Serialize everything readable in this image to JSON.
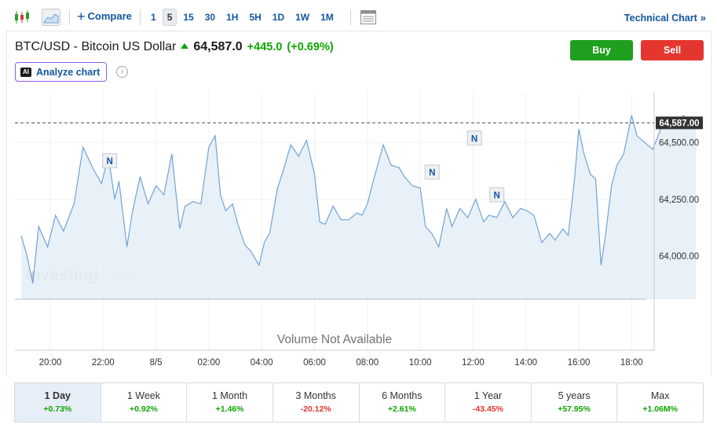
{
  "toolbar": {
    "compare_label": "Compare",
    "intervals": [
      "1",
      "5",
      "15",
      "30",
      "1H",
      "5H",
      "1D",
      "1W",
      "1M"
    ],
    "active_interval": "5",
    "technical_chart_label": "Technical Chart",
    "technical_chart_chevron": "»"
  },
  "asset": {
    "name": "BTC/USD - Bitcoin US Dollar",
    "price": "64,587.0",
    "change": "+445.0",
    "change_pct": "(+0.69%)",
    "direction_color": "#0ea600"
  },
  "actions": {
    "buy_label": "Buy",
    "sell_label": "Sell",
    "buy_color": "#1f9f1f",
    "sell_color": "#e5352f"
  },
  "analyze": {
    "badge": "AI",
    "label": "Analyze chart",
    "info_icon": "i"
  },
  "chart": {
    "watermark_brand": "Investing",
    "watermark_domain": ".com",
    "volume_message": "Volume Not Available",
    "news_marker": "N",
    "last_price_label": "64,587.00"
  },
  "chart_data": {
    "type": "area",
    "y_ticks": [
      "64,500.00",
      "64,250.00",
      "64,000.00"
    ],
    "y_tick_values": [
      64500,
      64250,
      64000
    ],
    "x_ticks": [
      "20:00",
      "22:00",
      "8/5",
      "02:00",
      "04:00",
      "06:00",
      "08:00",
      "10:00",
      "12:00",
      "14:00",
      "16:00",
      "18:00"
    ],
    "ylim": [
      63810,
      64720
    ],
    "last_price": 64587,
    "series": [
      {
        "color": "#6fa3d6",
        "fill": "#e4eef7",
        "x": [
          -0.55,
          -0.45,
          -0.33,
          -0.22,
          -0.05,
          0.1,
          0.25,
          0.45,
          0.62,
          0.8,
          0.97,
          1.1,
          1.22,
          1.3,
          1.45,
          1.55,
          1.7,
          1.85,
          2.0,
          2.15,
          2.3,
          2.45,
          2.55,
          2.7,
          2.85,
          3.0,
          3.12,
          3.22,
          3.32,
          3.45,
          3.55,
          3.68,
          3.8,
          3.95,
          4.05,
          4.15,
          4.3,
          4.4,
          4.55,
          4.7,
          4.85,
          5.0,
          5.1,
          5.2,
          5.35,
          5.5,
          5.65,
          5.8,
          5.9,
          6.0,
          6.1,
          6.3,
          6.45,
          6.6,
          6.7,
          6.85,
          7.0,
          7.1,
          7.22,
          7.35,
          7.5,
          7.6,
          7.75,
          7.9,
          8.05,
          8.2,
          8.3,
          8.45,
          8.6,
          8.75,
          8.9,
          9.02,
          9.15,
          9.3,
          9.45,
          9.55,
          9.7,
          9.8,
          9.92,
          10.0,
          10.1,
          10.22,
          10.32,
          10.42,
          10.5,
          10.62,
          10.72,
          10.85,
          11.0,
          11.1,
          11.25,
          11.4,
          11.55,
          11.7,
          11.85,
          11.98,
          12.1,
          12.22
        ],
        "y": [
          64090,
          64010,
          63880,
          64130,
          64040,
          64180,
          64110,
          64230,
          64480,
          64390,
          64320,
          64440,
          64250,
          64330,
          64040,
          64190,
          64350,
          64230,
          64310,
          64270,
          64450,
          64120,
          64220,
          64240,
          64230,
          64480,
          64530,
          64270,
          64200,
          64230,
          64140,
          64050,
          64020,
          63960,
          64060,
          64100,
          64300,
          64370,
          64490,
          64440,
          64510,
          64360,
          64150,
          64140,
          64220,
          64160,
          64160,
          64190,
          64180,
          64230,
          64320,
          64490,
          64400,
          64390,
          64350,
          64310,
          64300,
          64130,
          64100,
          64040,
          64210,
          64130,
          64210,
          64170,
          64250,
          64150,
          64180,
          64170,
          64240,
          64170,
          64210,
          64200,
          64180,
          64060,
          64100,
          64070,
          64120,
          64090,
          64340,
          64560,
          64450,
          64360,
          64340,
          63960,
          64080,
          64310,
          64400,
          64450,
          64620,
          64530,
          64500,
          64470,
          64560,
          64610,
          64580,
          64620,
          64587,
          64587
        ]
      }
    ],
    "news_x": [
      2.25,
      14.45,
      16.05,
      16.9
    ],
    "news_y": [
      64420,
      64370,
      64520,
      64270
    ]
  },
  "periods": [
    {
      "label": "1 Day",
      "change": "+0.73%",
      "sign": "pos"
    },
    {
      "label": "1 Week",
      "change": "+0.92%",
      "sign": "pos"
    },
    {
      "label": "1 Month",
      "change": "+1.46%",
      "sign": "pos"
    },
    {
      "label": "3 Months",
      "change": "-20.12%",
      "sign": "neg"
    },
    {
      "label": "6 Months",
      "change": "+2.61%",
      "sign": "pos"
    },
    {
      "label": "1 Year",
      "change": "-43.45%",
      "sign": "neg"
    },
    {
      "label": "5 years",
      "change": "+57.95%",
      "sign": "pos"
    },
    {
      "label": "Max",
      "change": "+1.06M%",
      "sign": "pos"
    }
  ],
  "active_period": "1 Day"
}
